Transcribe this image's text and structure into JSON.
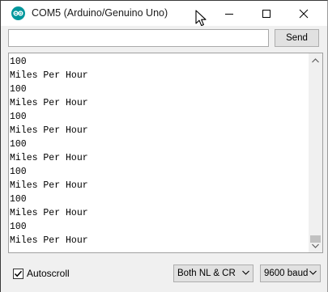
{
  "window": {
    "title": "COM5 (Arduino/Genuino Uno)"
  },
  "send_bar": {
    "input_value": "",
    "input_placeholder": "",
    "send_label": "Send"
  },
  "serial_output": {
    "lines": [
      "100",
      "Miles Per Hour",
      "100",
      "Miles Per Hour",
      "100",
      "Miles Per Hour",
      "100",
      "Miles Per Hour",
      "100",
      "Miles Per Hour",
      "100",
      "Miles Per Hour",
      "100",
      "Miles Per Hour"
    ]
  },
  "status_bar": {
    "autoscroll_label": "Autoscroll",
    "autoscroll_checked": true,
    "line_ending": "Both NL & CR",
    "baud_rate": "9600 baud"
  },
  "colors": {
    "arduino_teal": "#00979c",
    "desktop_blue": "#2a8dd6"
  },
  "icons": {
    "app": "arduino-icon",
    "minimize": "minimize-icon",
    "maximize": "maximize-icon",
    "close": "close-icon",
    "cursor": "mouse-pointer-icon"
  }
}
